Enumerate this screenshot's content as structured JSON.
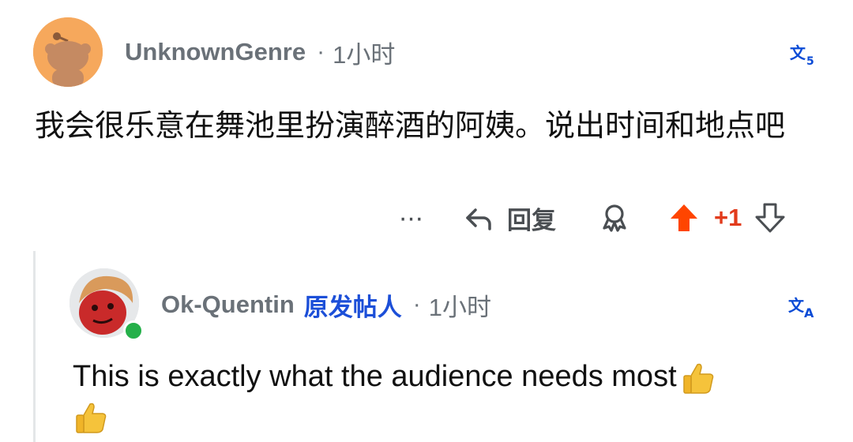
{
  "comment": {
    "username": "UnknownGenre",
    "separator": "·",
    "time": "1小时",
    "body": "我会很乐意在舞池里扮演醉酒的阿姨。说出时间和地点吧",
    "translate_icon": "translate-icon"
  },
  "actions": {
    "more_label": "···",
    "reply_label": "回复",
    "score": "+1",
    "icons": [
      "more-icon",
      "reply-icon",
      "award-icon",
      "upvote-icon",
      "downvote-icon"
    ],
    "colors": {
      "upvote": "#ff4500",
      "score": "#e23b1c",
      "icon": "#4a4e52"
    }
  },
  "reply": {
    "username": "Ok-Quentin",
    "op_badge": "原发帖人",
    "separator": "·",
    "time": "1小时",
    "body": "This is exactly what the audience needs most",
    "emoji": [
      "thumbs-up",
      "thumbs-up"
    ],
    "online_status": "online",
    "colors": {
      "op_badge": "#1c4fd8",
      "online": "#25b04a"
    }
  }
}
